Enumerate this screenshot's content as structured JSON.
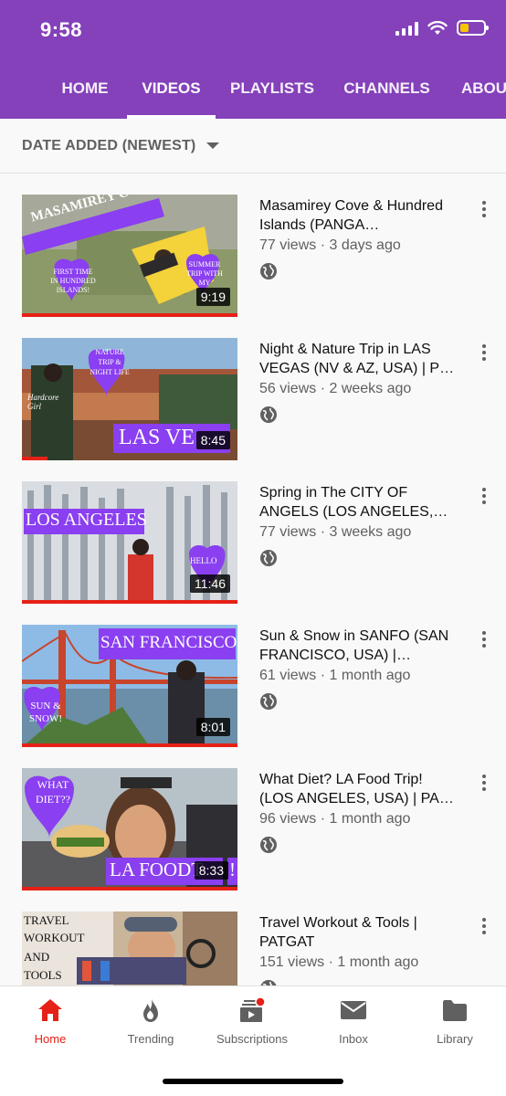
{
  "status": {
    "time": "9:58"
  },
  "tabs": [
    {
      "label": "HOME"
    },
    {
      "label": "VIDEOS"
    },
    {
      "label": "PLAYLISTS"
    },
    {
      "label": "CHANNELS"
    },
    {
      "label": "ABOUT"
    }
  ],
  "active_tab": "VIDEOS",
  "sort": {
    "label": "DATE ADDED (NEWEST)"
  },
  "videos": [
    {
      "title": "Masamirey Cove & Hundred Islands (PANGA…",
      "meta": "77 views · 3 days ago",
      "duration": "9:19",
      "thumb_text": [
        "MASAMIREY COVE",
        "FIRST TIME IN HUNDRED ISLANDS!",
        "SUMMER TRIP WITH MY"
      ]
    },
    {
      "title": "Night & Nature Trip in LAS VEGAS (NV & AZ, USA) | P…",
      "meta": "56 views · 2 weeks ago",
      "duration": "8:45",
      "thumb_text": [
        "NATURE TRIP & NIGHT LIFE",
        "LAS VE",
        "Hardcore Girl"
      ]
    },
    {
      "title": "Spring in The CITY OF ANGELS (LOS ANGELES,…",
      "meta": "77 views · 3 weeks ago",
      "duration": "11:46",
      "thumb_text": [
        "LOS ANGELES",
        "HELLO"
      ]
    },
    {
      "title": "Sun & Snow in SANFO (SAN FRANCISCO, USA) |…",
      "meta": "61 views · 1 month ago",
      "duration": "8:01",
      "thumb_text": [
        "SAN FRANCISCO",
        "SUN & SNOW!"
      ]
    },
    {
      "title": "What Diet? LA Food Trip! (LOS ANGELES, USA) | PA…",
      "meta": "96 views · 1 month ago",
      "duration": "8:33",
      "thumb_text": [
        "WHAT DIET??",
        "LA FOODT",
        "!"
      ]
    },
    {
      "title": "Travel Workout & Tools | PATGAT",
      "meta": "151 views · 1 month ago",
      "duration": "",
      "thumb_text": [
        "TRAVEL",
        "WORKOUT",
        "AND",
        "TOOLS"
      ]
    }
  ],
  "bottom_nav": [
    {
      "label": "Home",
      "icon": "home-icon"
    },
    {
      "label": "Trending",
      "icon": "flame-icon"
    },
    {
      "label": "Subscriptions",
      "icon": "subscriptions-icon"
    },
    {
      "label": "Inbox",
      "icon": "inbox-icon"
    },
    {
      "label": "Library",
      "icon": "library-icon"
    }
  ],
  "colors": {
    "brand": "#8441ba",
    "accent": "#e62117",
    "thumb_purple": "#8a3ff0"
  }
}
